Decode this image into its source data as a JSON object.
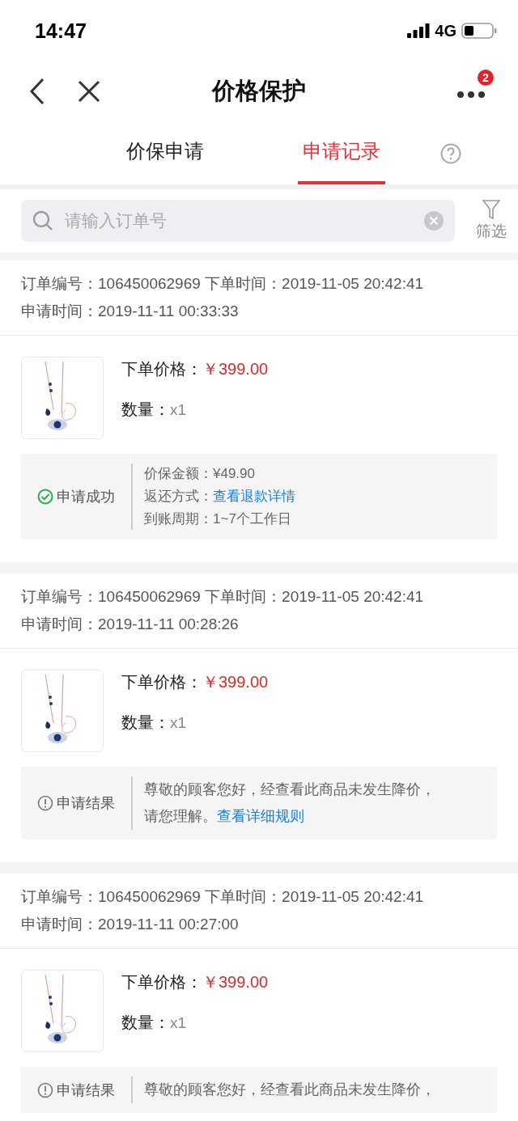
{
  "status_bar": {
    "time": "14:47",
    "network": "4G"
  },
  "nav": {
    "title": "价格保护",
    "badge": "2"
  },
  "tabs": [
    {
      "label": "价保申请",
      "selected": false
    },
    {
      "label": "申请记录",
      "selected": true
    }
  ],
  "search": {
    "placeholder": "请输入订单号",
    "filter": "筛选"
  },
  "records": [
    {
      "order_line": "订单编号：106450062969 下单时间：2019-11-05 20:42:41",
      "apply_line": "申请时间：2019-11-11 00:33:33",
      "price_label": "下单价格：",
      "price": "￥399.00",
      "qty_label": "数量：",
      "qty": "x1",
      "result": {
        "kind": "success",
        "status": "申请成功",
        "lines": [
          {
            "label": "价保金额：",
            "value": "¥49.90",
            "link": false
          },
          {
            "label": "返还方式：",
            "value": "查看退款详情",
            "link": true
          },
          {
            "label": "到账周期：",
            "value": "1~7个工作日",
            "link": false
          }
        ]
      }
    },
    {
      "order_line": "订单编号：106450062969 下单时间：2019-11-05 20:42:41",
      "apply_line": "申请时间：2019-11-11 00:28:26",
      "price_label": "下单价格：",
      "price": "￥399.00",
      "qty_label": "数量：",
      "qty": "x1",
      "result": {
        "kind": "notice",
        "status": "申请结果",
        "message": "尊敬的顾客您好，经查看此商品未发生降价，请您理解。",
        "link": "查看详细规则"
      }
    },
    {
      "order_line": "订单编号：106450062969 下单时间：2019-11-05 20:42:41",
      "apply_line": "申请时间：2019-11-11 00:27:00",
      "price_label": "下单价格：",
      "price": "￥399.00",
      "qty_label": "数量：",
      "qty": "x1",
      "result": {
        "kind": "notice",
        "status": "申请结果",
        "message": "尊敬的顾客您好，经查看此商品未发生降价，"
      }
    }
  ]
}
